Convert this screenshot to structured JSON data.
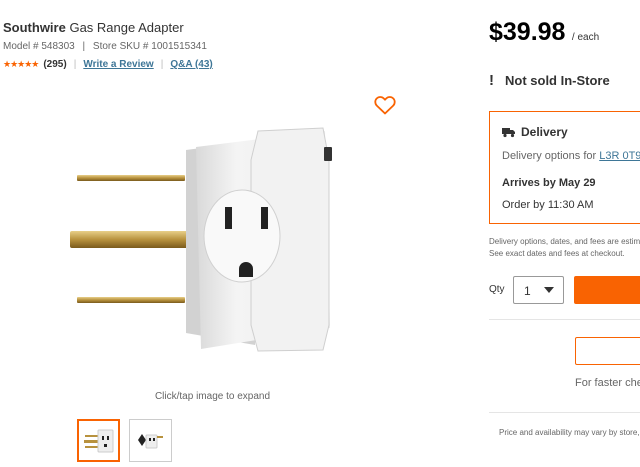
{
  "product": {
    "brand": "Southwire",
    "name": "Gas Range Adapter",
    "model_label": "Model # 548303",
    "sku_label": "Store SKU # 1001515341",
    "stars": "★★★★★",
    "rating_count": "(295)",
    "write_review": "Write a Review",
    "qa": "Q&A (43)"
  },
  "gallery": {
    "expand_text": "Click/tap image to expand"
  },
  "buybox": {
    "price": "$39.98",
    "price_unit": "/ each",
    "not_sold": "Not sold In-Store",
    "delivery": {
      "title": "Delivery",
      "options_prefix": "Delivery options for",
      "postal_code": "L3R 0T9",
      "arrives": "Arrives by May 29",
      "order_by": "Order by 11:30 AM"
    },
    "disclaimer_line1": "Delivery options, dates, and fees are estim",
    "disclaimer_line2": "See exact dates and fees at checkout.",
    "qty_label": "Qty",
    "qty_value": "1",
    "faster_text": "For faster che",
    "price_note": "Price and availability may vary by store,"
  },
  "colors": {
    "accent": "#f96302",
    "link": "#3e7697"
  }
}
